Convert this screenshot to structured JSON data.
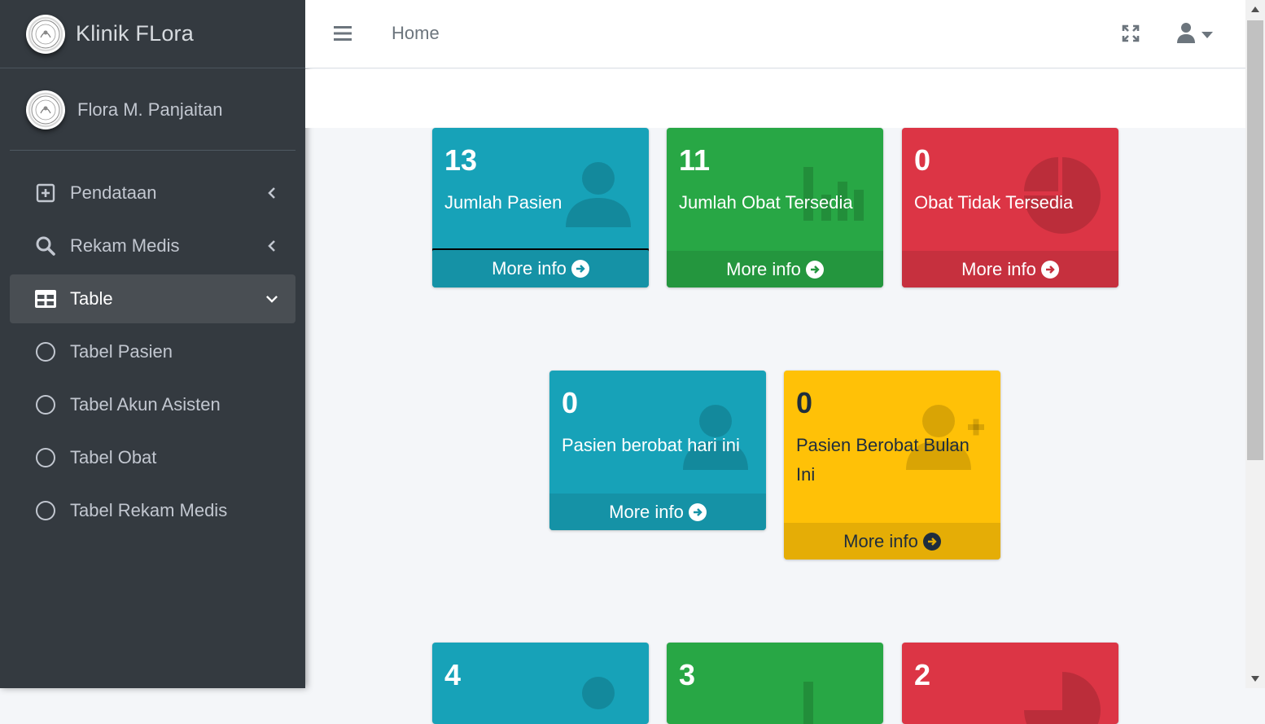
{
  "brand": {
    "name": "Klinik FLora",
    "logo_icon": "clinic-logo"
  },
  "user": {
    "name": "Flora M. Panjaitan"
  },
  "sidebar": {
    "items": [
      {
        "label": "Pendataan",
        "icon": "plus-square-icon"
      },
      {
        "label": "Rekam Medis",
        "icon": "search-icon"
      },
      {
        "label": "Table",
        "icon": "table-icon"
      },
      {
        "label": "Tabel Pasien",
        "icon": "circle-icon"
      },
      {
        "label": "Tabel Akun Asisten",
        "icon": "circle-icon"
      },
      {
        "label": "Tabel Obat",
        "icon": "circle-icon"
      },
      {
        "label": "Tabel Rekam Medis",
        "icon": "circle-icon"
      }
    ]
  },
  "header": {
    "home_label": "Home"
  },
  "colors": {
    "info": "#17a2b8",
    "success": "#28a745",
    "danger": "#dc3545",
    "warning": "#ffc107",
    "sidebar": "#343a40"
  },
  "boxes": [
    {
      "value": "13",
      "label": "Jumlah Pasien",
      "footer": "More info",
      "icon": "user-icon"
    },
    {
      "value": "11",
      "label": "Jumlah Obat Tersedia",
      "footer": "More info",
      "icon": "bar-chart-icon"
    },
    {
      "value": "0",
      "label": "Obat Tidak Tersedia",
      "footer": "More info",
      "icon": "pie-chart-icon"
    },
    {
      "value": "0",
      "label": "Pasien berobat hari ini",
      "footer": "More info",
      "icon": "user-icon"
    },
    {
      "value": "0",
      "label": "Pasien Berobat Bulan Ini",
      "footer": "More info",
      "icon": "user-plus-icon"
    },
    {
      "value": "4"
    },
    {
      "value": "3"
    },
    {
      "value": "2"
    }
  ]
}
